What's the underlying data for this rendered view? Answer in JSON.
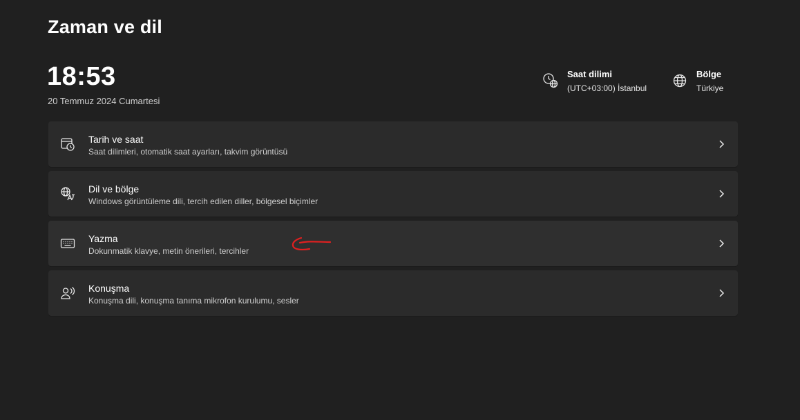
{
  "page": {
    "title": "Zaman ve dil"
  },
  "clock": {
    "time": "18:53",
    "date": "20 Temmuz 2024 Cumartesi"
  },
  "timezone": {
    "label": "Saat dilimi",
    "value": "(UTC+03:00) İstanbul",
    "icon": "clock-globe-icon"
  },
  "region": {
    "label": "Bölge",
    "value": "Türkiye",
    "icon": "globe-icon"
  },
  "cards": [
    {
      "title": "Tarih ve saat",
      "subtitle": "Saat dilimleri, otomatik saat ayarları, takvim görüntüsü",
      "icon": "calendar-clock-icon"
    },
    {
      "title": "Dil ve bölge",
      "subtitle": "Windows görüntüleme dili, tercih edilen diller, bölgesel biçimler",
      "icon": "language-icon"
    },
    {
      "title": "Yazma",
      "subtitle": "Dokunmatik klavye, metin önerileri, tercihler",
      "icon": "keyboard-icon"
    },
    {
      "title": "Konuşma",
      "subtitle": "Konuşma dili, konuşma tanıma mikrofon kurulumu, sesler",
      "icon": "speech-icon"
    }
  ],
  "colors": {
    "background": "#202020",
    "card": "#2b2b2b",
    "annotation": "#e02020"
  }
}
